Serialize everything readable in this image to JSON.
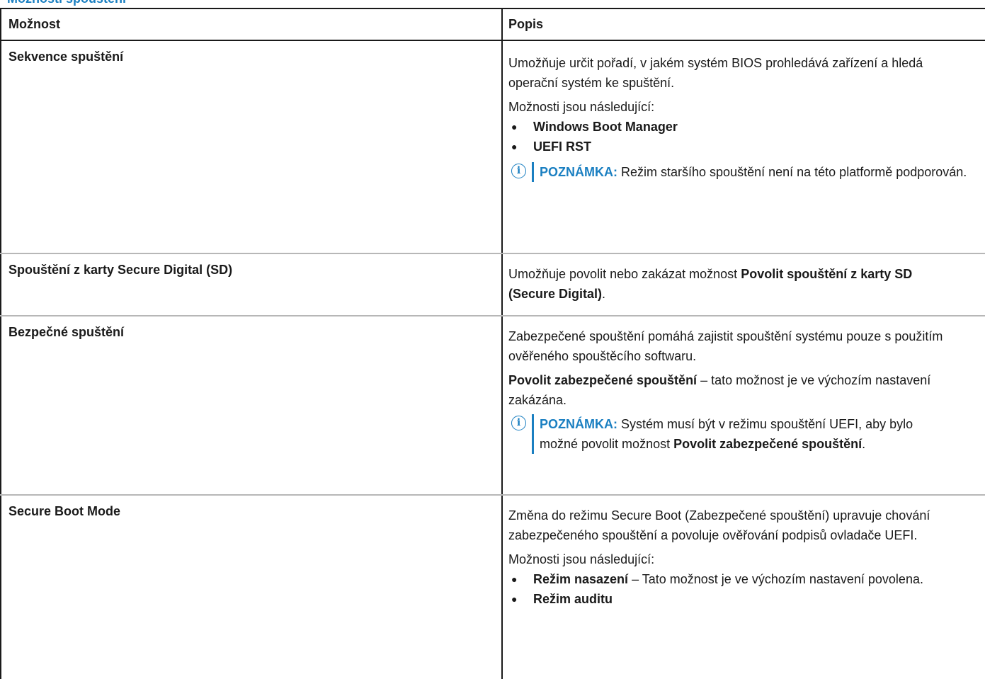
{
  "header": {
    "partial_heading": "Možnosti spouštění"
  },
  "table": {
    "columns": [
      "Možnost",
      "Popis"
    ],
    "rows": [
      {
        "option": "Sekvence spuštění",
        "desc": {
          "p1": "Umožňuje určit pořadí, v jakém systém BIOS prohledává zařízení a hledá operační systém ke spuštění.",
          "p2": "Možnosti jsou následující:",
          "items": [
            "Windows Boot Manager",
            "UEFI RST"
          ],
          "note_label": "POZNÁMKA:",
          "note_text": "Režim staršího spouštění není na této platformě podporován."
        }
      },
      {
        "option": "Spouštění z karty Secure Digital (SD)",
        "desc": {
          "pre": "Umožňuje povolit nebo zakázat možnost ",
          "bold": "Povolit spouštění z karty SD (Secure Digital)",
          "post": "."
        }
      },
      {
        "option": "Bezpečné spuštění",
        "desc": {
          "p1": "Zabezpečené spouštění pomáhá zajistit spouštění systému pouze s použitím ověřeného spouštěcího softwaru.",
          "p2_bold": "Povolit zabezpečené spouštění",
          "p2_rest": " – tato možnost je ve výchozím nastavení zakázána.",
          "note_label": "POZNÁMKA:",
          "note_pre": " Systém musí být v režimu spouštění UEFI, aby bylo možné povolit možnost ",
          "note_bold": "Povolit zabezpečené spouštění",
          "note_post": "."
        }
      },
      {
        "option": "Secure Boot Mode",
        "desc": {
          "p1": "Změna do režimu Secure Boot (Zabezpečené spouštění) upravuje chování zabezpečeného spouštění a povoluje ověřování podpisů ovladače UEFI.",
          "p2": "Možnosti jsou následující:",
          "item1_bold": "Režim nasazení",
          "item1_rest": " – Tato možnost je ve výchozím nastavení povolena.",
          "item2_bold": "Režim auditu"
        }
      }
    ]
  },
  "icons": {
    "note": "info-icon",
    "bullet": "bullet-icon"
  },
  "colors": {
    "accent": "#1a7fc1",
    "text": "#1a1a1a",
    "row_rule": "#b7b7b7"
  }
}
